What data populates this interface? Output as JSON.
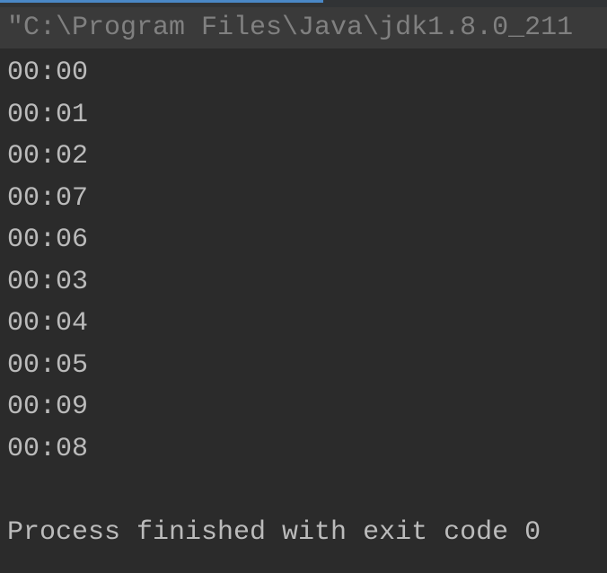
{
  "commandLine": "\"C:\\Program Files\\Java\\jdk1.8.0_211",
  "output": {
    "lines": [
      "00:00",
      "00:01",
      "00:02",
      "00:07",
      "00:06",
      "00:03",
      "00:04",
      "00:05",
      "00:09",
      "00:08"
    ]
  },
  "exitMessage": "Process finished with exit code 0"
}
